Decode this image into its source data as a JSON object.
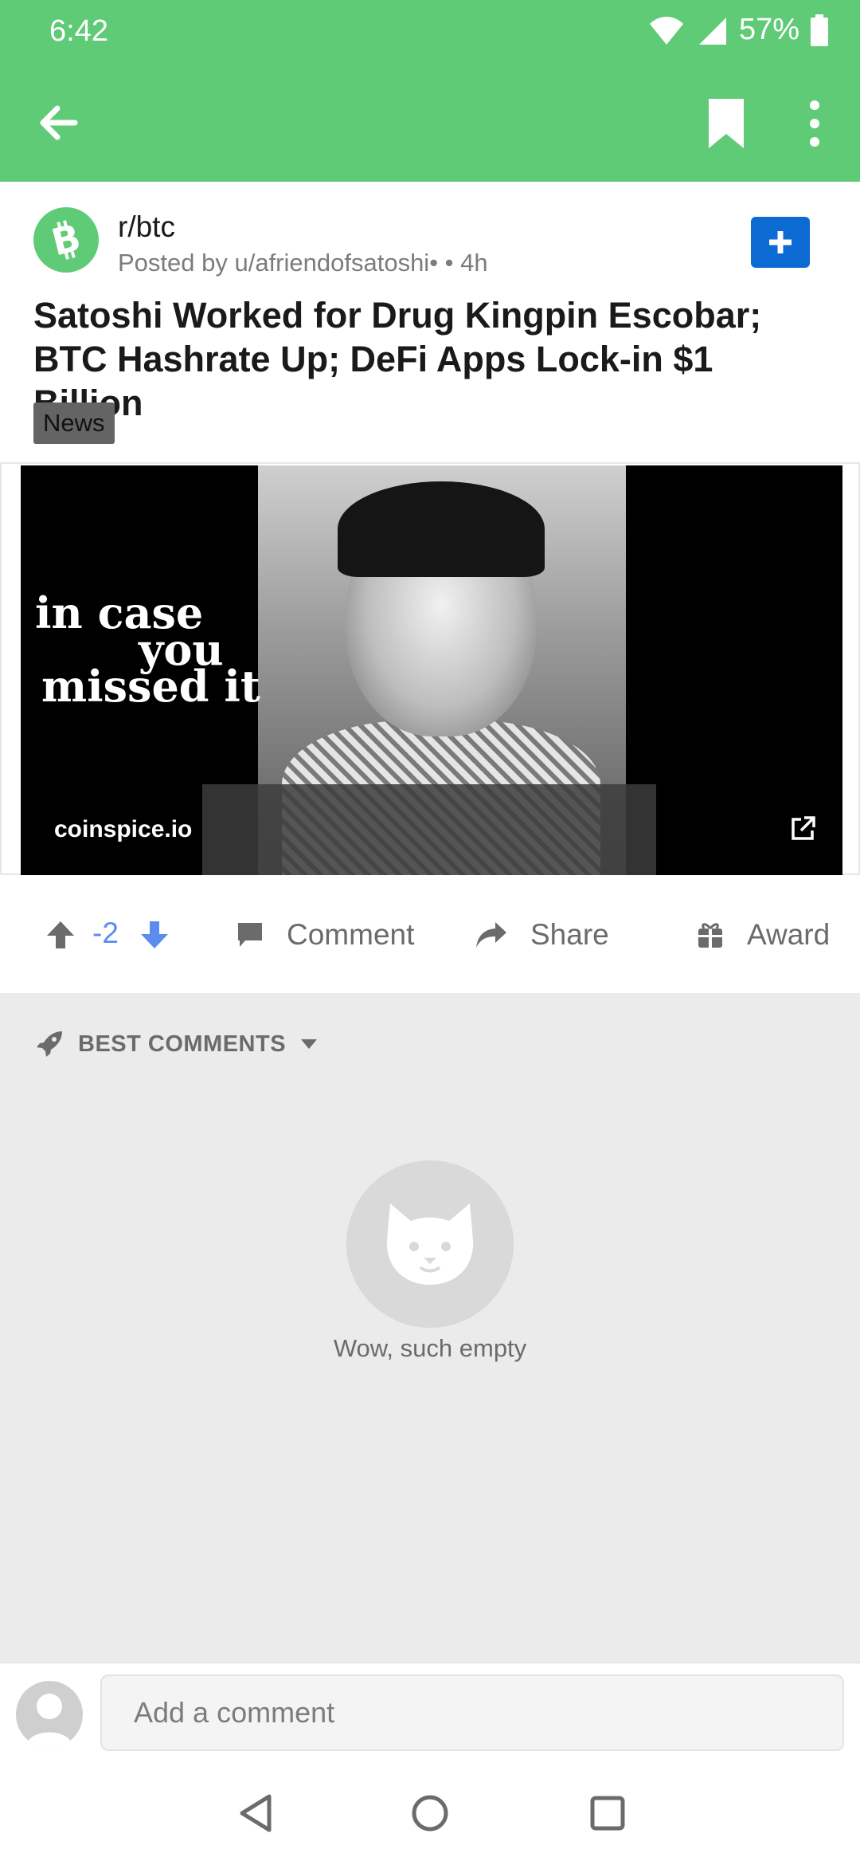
{
  "status_bar": {
    "time": "6:42",
    "battery": "57%"
  },
  "app_bar": {
    "back": "back",
    "bookmark": "bookmark",
    "more": "more options"
  },
  "post": {
    "subreddit": "r/btc",
    "posted_by": "Posted by u/afriendofsatoshi• • 4h",
    "title": "Satoshi Worked for Drug Kingpin Escobar; BTC Hashrate Up; DeFi Apps Lock-in $1 Billion",
    "flair": "News",
    "preview": {
      "overlay_line1": "in case",
      "overlay_line2": "you",
      "overlay_line3": "missed it",
      "domain": "coinspice.io"
    }
  },
  "actions": {
    "score": "-2",
    "comment_label": "Comment",
    "share_label": "Share",
    "award_label": "Award"
  },
  "comments": {
    "sort_label": "BEST COMMENTS",
    "empty_text": "Wow, such empty"
  },
  "composer": {
    "placeholder": "Add a comment"
  },
  "colors": {
    "brand_green": "#5fcb76",
    "join_blue": "#0b6bd3",
    "score_blue": "#5b8def"
  }
}
